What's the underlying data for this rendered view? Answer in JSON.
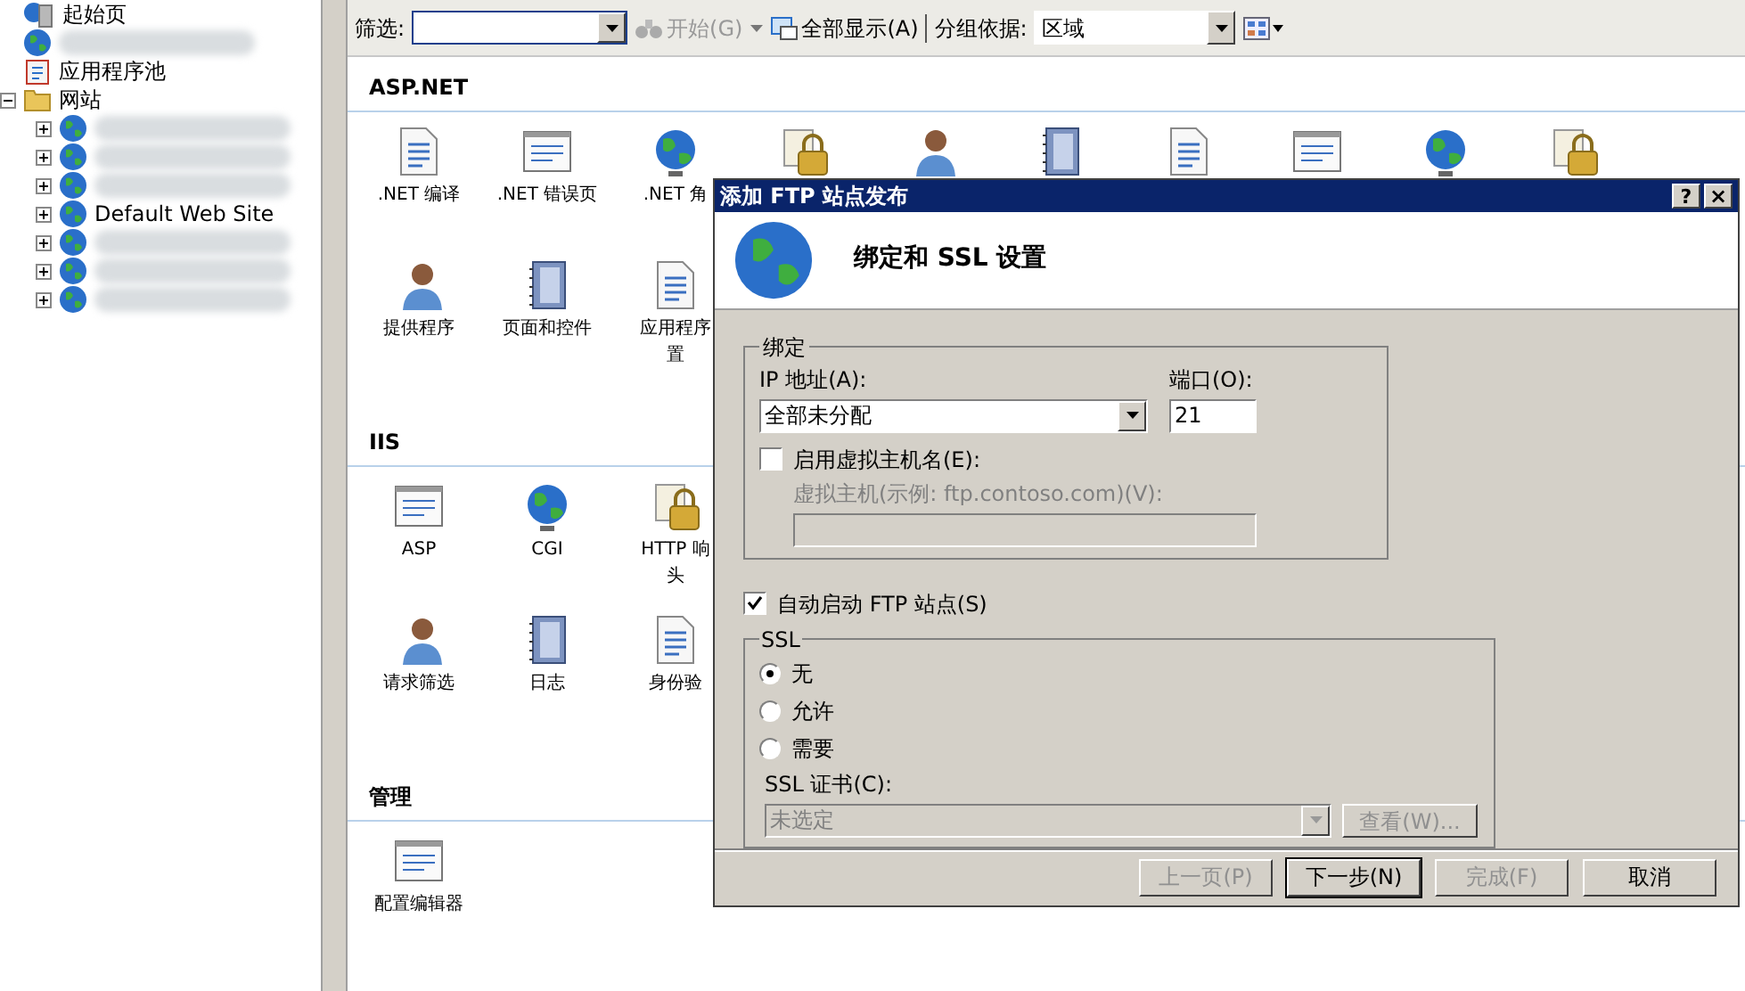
{
  "tree": {
    "items": [
      {
        "kind": "start",
        "label": "起始页"
      },
      {
        "kind": "redacted"
      },
      {
        "kind": "pools",
        "label": "应用程序池"
      },
      {
        "kind": "sites",
        "label": "网站",
        "expanded": true,
        "children": [
          {
            "kind": "redacted",
            "expanded": false
          },
          {
            "kind": "redacted",
            "expanded": false
          },
          {
            "kind": "redacted",
            "expanded": false
          },
          {
            "kind": "site",
            "label": "Default Web Site",
            "expanded": false
          },
          {
            "kind": "redacted",
            "expanded": false
          },
          {
            "kind": "redacted",
            "expanded": false
          },
          {
            "kind": "redacted",
            "expanded": false
          }
        ]
      }
    ]
  },
  "toolbar": {
    "filter_label": "筛选:",
    "go": "开始(G)",
    "show_all": "全部显示(A)",
    "group_label": "分组依据:",
    "group_value": "区域"
  },
  "sections": [
    {
      "title": "ASP.NET",
      "rows": [
        [
          {
            "label": [
              ".NET 编译"
            ]
          },
          {
            "label": [
              ".NET 错误页"
            ]
          },
          {
            "label": [
              ".NET 角"
            ]
          },
          {},
          {},
          {},
          {},
          {},
          {},
          {}
        ],
        [
          {
            "label": [
              "提供程序"
            ]
          },
          {
            "label": [
              "页面和控件"
            ]
          },
          {
            "label": [
              "应用程序",
              "置"
            ]
          }
        ]
      ]
    },
    {
      "title": "IIS",
      "rows": [
        [
          {
            "label": [
              "ASP"
            ]
          },
          {
            "label": [
              "CGI"
            ]
          },
          {
            "label": [
              "HTTP 响",
              "头"
            ]
          }
        ],
        [
          {
            "label": [
              "请求筛选"
            ]
          },
          {
            "label": [
              "日志"
            ]
          },
          {
            "label": [
              "身份验"
            ]
          }
        ]
      ]
    },
    {
      "title": "管理",
      "rows": [
        [
          {
            "label": [
              "配置编辑器"
            ]
          }
        ]
      ]
    }
  ],
  "dialog": {
    "title": "添加 FTP 站点发布",
    "help": "?",
    "close": "×",
    "heading": "绑定和 SSL 设置",
    "binding": {
      "legend": "绑定",
      "ip_label": "IP 地址(A):",
      "ip_value": "全部未分配",
      "port_label": "端口(O):",
      "port_value": "21",
      "virtual_host": {
        "label": "启用虚拟主机名(E):",
        "checked": false
      },
      "host_label": "虚拟主机(示例: ftp.contoso.com)(V):",
      "host_disabled": true
    },
    "auto_start": {
      "label": "自动启动 FTP 站点(S)",
      "checked": true
    },
    "ssl": {
      "legend": "SSL",
      "options": [
        {
          "label": "无",
          "selected": true
        },
        {
          "label": "允许",
          "selected": false
        },
        {
          "label": "需要",
          "selected": false
        }
      ],
      "cert_label": "SSL 证书(C):",
      "cert_value": "未选定",
      "cert_disabled": true,
      "view": {
        "label": "查看(W)...",
        "disabled": true
      }
    },
    "buttons": [
      {
        "label": "上一页(P)",
        "disabled": true,
        "default": false
      },
      {
        "label": "下一步(N)",
        "disabled": false,
        "default": true
      },
      {
        "label": "完成(F)",
        "disabled": true,
        "default": false
      },
      {
        "label": "取消",
        "disabled": false,
        "default": false
      }
    ]
  }
}
